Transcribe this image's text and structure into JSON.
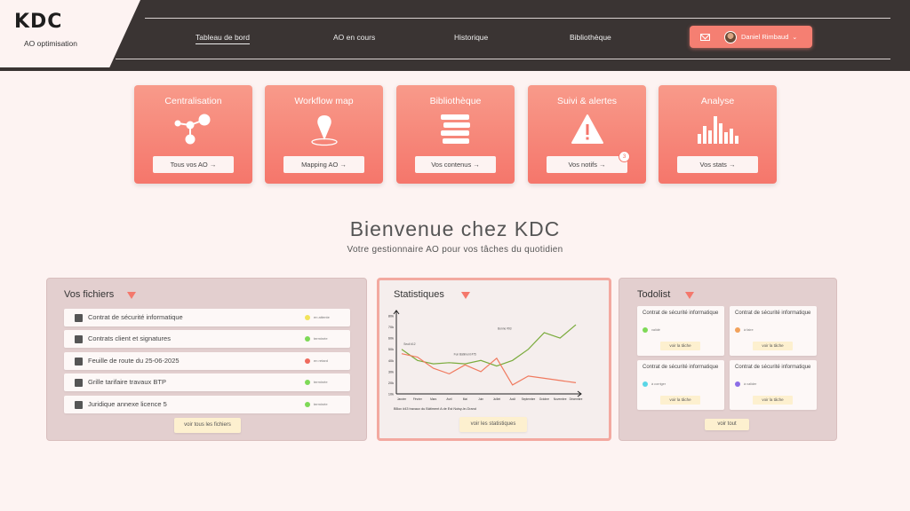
{
  "brand": {
    "name": "KDC",
    "subtitle": "AO optimisation"
  },
  "nav": [
    {
      "label": "Tableau de bord",
      "active": true
    },
    {
      "label": "AO en cours"
    },
    {
      "label": "Historique"
    },
    {
      "label": "Bibliothèque"
    }
  ],
  "user": {
    "name": "Daniel Rimbaud",
    "caret": "⌄",
    "icons": [
      "mail-icon",
      "avatar"
    ]
  },
  "cards": [
    {
      "title": "Centralisation",
      "button": "Tous vos AO →",
      "icon": "network-icon"
    },
    {
      "title": "Workflow map",
      "button": "Mapping AO →",
      "icon": "map-pin-icon"
    },
    {
      "title": "Bibliothèque",
      "button": "Vos contenus →",
      "icon": "stack-icon"
    },
    {
      "title": "Suivi & alertes",
      "button": "Vos notifs →",
      "icon": "warning-icon",
      "badge": "3"
    },
    {
      "title": "Analyse",
      "button": "Vos stats →",
      "icon": "bar-chart-icon"
    }
  ],
  "welcome": {
    "title": "Bienvenue chez KDC",
    "subtitle": "Votre gestionnaire AO pour vos tâches du quotidien"
  },
  "files": {
    "title": "Vos fichiers",
    "items": [
      {
        "name": "Contrat de sécurité informatique",
        "status": "en attente",
        "color": "#f2e35b"
      },
      {
        "name": "Contrats client et signatures",
        "status": "terminée",
        "color": "#7ed957"
      },
      {
        "name": "Feuille de route du 25-06-2025",
        "status": "en retard",
        "color": "#ef6b5e"
      },
      {
        "name": "Grille tarifaire travaux BTP",
        "status": "terminée",
        "color": "#7ed957"
      },
      {
        "name": "Juridique annexe licence 5",
        "status": "terminée",
        "color": "#7ed957"
      }
    ],
    "button": "voir tous les fichiers"
  },
  "stats": {
    "title": "Statistiques",
    "button": "voir les statistiques",
    "caption": "BBox #43 travaux du Bâtiment A de Est Noisy-le-Grand"
  },
  "chart_data": {
    "type": "line",
    "ylim": [
      10,
      80
    ],
    "yticks": [
      "10k",
      "20k",
      "30k",
      "40k",
      "50k",
      "60k",
      "70k",
      "80k"
    ],
    "categories": [
      "Janvier",
      "Février",
      "Mars",
      "Avril",
      "Mai",
      "Juin",
      "Juillet",
      "Août",
      "Septembre",
      "Octobre",
      "Novembre",
      "Décembre"
    ],
    "series": [
      {
        "color": "#7aab3c",
        "values": [
          50,
          40,
          37,
          38,
          37,
          40,
          35,
          40,
          50,
          65,
          60,
          72
        ]
      },
      {
        "color": "#f07a5f",
        "values": [
          46,
          43,
          33,
          28,
          36,
          30,
          42,
          18,
          26,
          24,
          22,
          20
        ]
      }
    ],
    "annotations": [
      "Seuil #12",
      "Fun Bâtiment #75",
      "Bonne #93"
    ],
    "grid": false
  },
  "todo": {
    "title": "Todolist",
    "items": [
      {
        "title": "Contrat de sécurité informatique",
        "status": "validé",
        "color": "#7ed957",
        "button": "voir la tâche"
      },
      {
        "title": "Contrat de sécurité informatique",
        "status": "à faire",
        "color": "#f2a25b",
        "button": "voir la tâche"
      },
      {
        "title": "Contrat de sécurité informatique",
        "status": "à corriger",
        "color": "#5ad6e6",
        "button": "voir la tâche"
      },
      {
        "title": "Contrat de sécurité informatique",
        "status": "à valider",
        "color": "#8c6ee6",
        "button": "voir la tâche"
      }
    ],
    "button": "voir tout"
  }
}
